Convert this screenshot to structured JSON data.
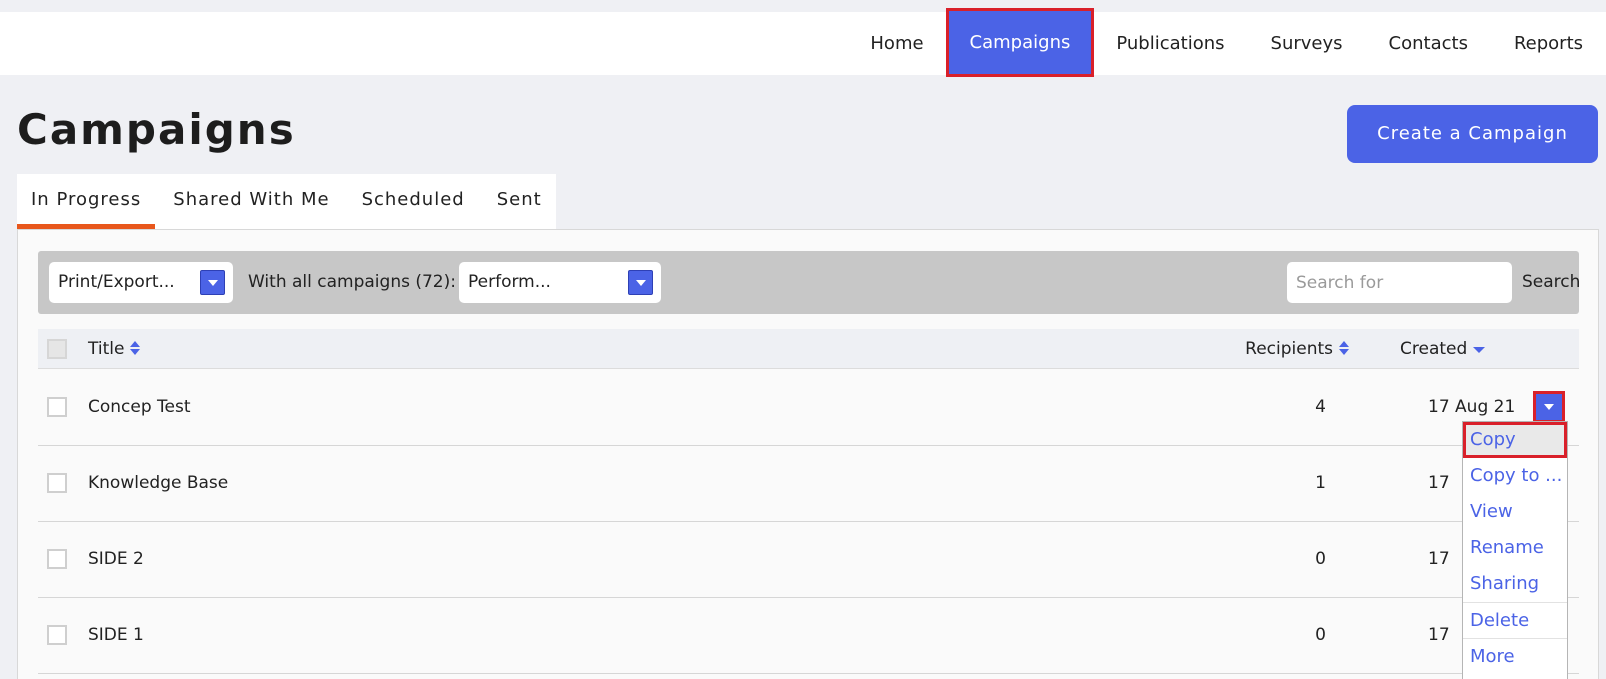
{
  "nav": {
    "items": [
      "Home",
      "Campaigns",
      "Publications",
      "Surveys",
      "Contacts",
      "Reports"
    ],
    "active": "Campaigns"
  },
  "page": {
    "title": "Campaigns",
    "create_button": "Create a Campaign"
  },
  "tabs": [
    "In Progress",
    "Shared With Me",
    "Scheduled",
    "Sent"
  ],
  "active_tab": "In Progress",
  "toolbar": {
    "print_export": "Print/Export...",
    "with_all_label": "With all campaigns (72):",
    "perform": "Perform...",
    "search_placeholder": "Search for",
    "search_button": "Search"
  },
  "table": {
    "headers": {
      "title": "Title",
      "recipients": "Recipients",
      "created": "Created"
    },
    "rows": [
      {
        "title": "Concep Test",
        "recipients": "4",
        "created": "17 Aug 21"
      },
      {
        "title": "Knowledge Base",
        "recipients": "1",
        "created": "17"
      },
      {
        "title": "SIDE 2",
        "recipients": "0",
        "created": "17"
      },
      {
        "title": "SIDE 1",
        "recipients": "0",
        "created": "17"
      }
    ]
  },
  "row_menu": {
    "items": [
      "Copy",
      "Copy to ...",
      "View",
      "Rename",
      "Sharing",
      "Delete",
      "More"
    ],
    "highlighted": "Copy"
  },
  "colors": {
    "accent": "#4b63e6",
    "highlight_border": "#d9202a",
    "active_tab_underline": "#e8571c"
  }
}
